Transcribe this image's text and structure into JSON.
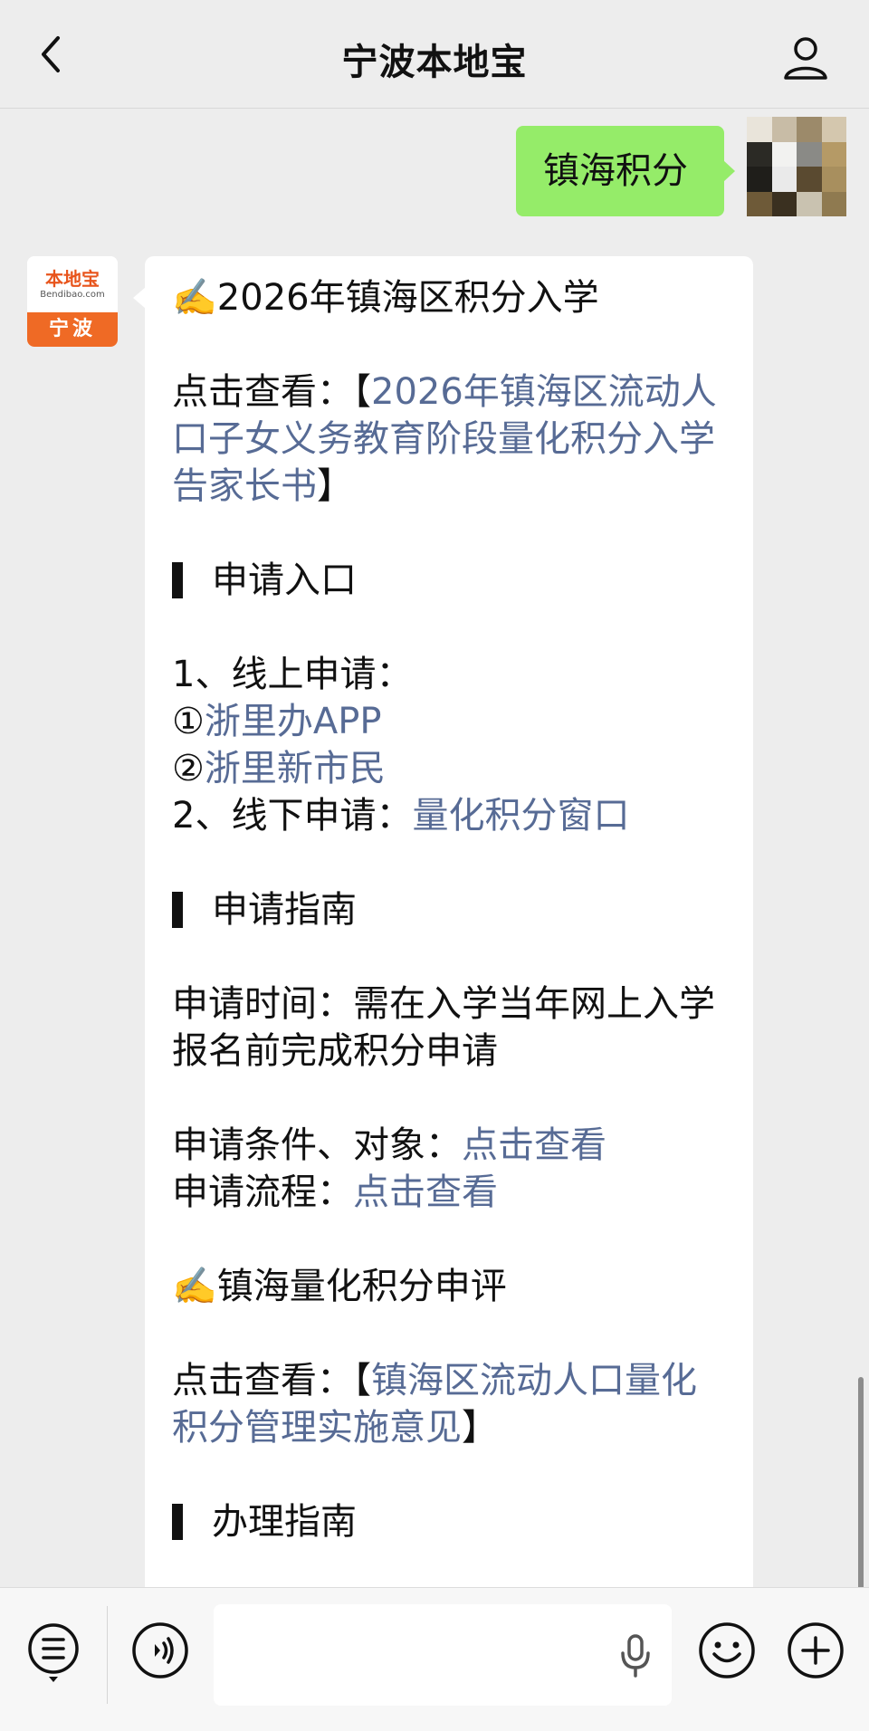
{
  "header": {
    "title": "宁波本地宝"
  },
  "outgoing_message": {
    "text": "镇海积分"
  },
  "bot": {
    "avatar_brand": "本地宝",
    "avatar_sub": "Bendibao.com",
    "avatar_city": "宁波"
  },
  "message": {
    "heading1": "✍️2026年镇海区积分入学",
    "view1_prefix": "点击查看：【",
    "view1_link": "2026年镇海区流动人口子女义务教育阶段量化积分入学告家长书",
    "view1_suffix": "】",
    "section_apply_entry": "申请入口",
    "online_apply": "1、线上申请：",
    "option1_mark": "①",
    "option1_link": "浙里办APP",
    "option2_mark": "②",
    "option2_link": "浙里新市民",
    "offline_apply": "2、线下申请：",
    "offline_link": "量化积分窗口",
    "section_guide": "申请指南",
    "apply_time": "申请时间：需在入学当年网上入学报名前完成积分申请",
    "conditions_label": "申请条件、对象：",
    "conditions_link": "点击查看",
    "process_label": "申请流程：",
    "process_link": "点击查看",
    "heading2": "✍️镇海量化积分申评",
    "view2_prefix": "点击查看：【",
    "view2_link": "镇海区流动人口量化积分管理实施意见",
    "view2_suffix": "】",
    "section_handling": "办理指南"
  },
  "colors": {
    "link": "#576b95",
    "outgoing_bubble": "#95ec69",
    "background": "#ededed"
  }
}
